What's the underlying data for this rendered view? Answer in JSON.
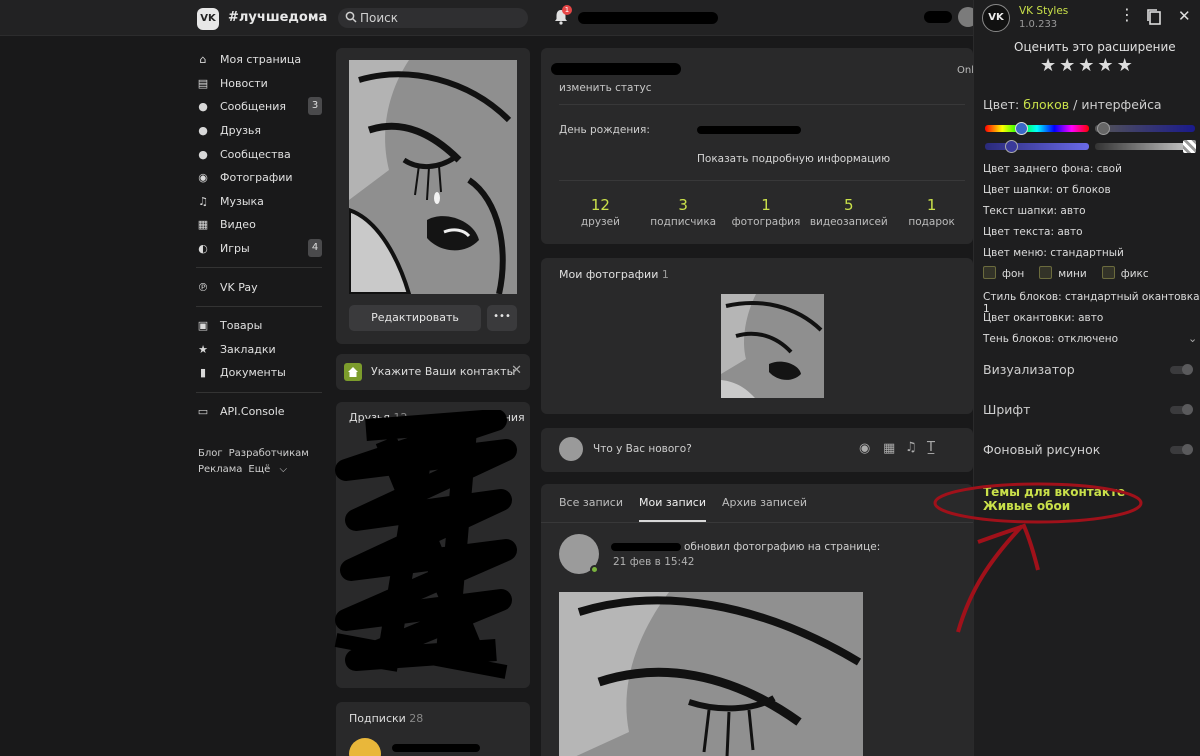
{
  "header": {
    "logo": "VK",
    "brand": "#лучшедома",
    "search_placeholder": "Поиск",
    "notif_count": "1"
  },
  "menu": [
    {
      "icon": "home-icon",
      "label": "Моя страница",
      "count": ""
    },
    {
      "icon": "news-icon",
      "label": "Новости",
      "count": ""
    },
    {
      "icon": "messages-icon",
      "label": "Сообщения",
      "count": "3"
    },
    {
      "icon": "friends-icon",
      "label": "Друзья",
      "count": ""
    },
    {
      "icon": "communities-icon",
      "label": "Сообщества",
      "count": ""
    },
    {
      "icon": "camera-icon",
      "label": "Фотографии",
      "count": ""
    },
    {
      "icon": "music-icon",
      "label": "Музыка",
      "count": ""
    },
    {
      "icon": "video-icon",
      "label": "Видео",
      "count": ""
    },
    {
      "icon": "gamepad-icon",
      "label": "Игры",
      "count": "4"
    }
  ],
  "menu2": [
    {
      "icon": "vkpay-icon",
      "label": "VK Pay"
    }
  ],
  "menu3": [
    {
      "icon": "bag-icon",
      "label": "Товары"
    },
    {
      "icon": "star-icon",
      "label": "Закладки"
    },
    {
      "icon": "document-icon",
      "label": "Документы"
    }
  ],
  "menu4": [
    {
      "icon": "api-icon",
      "label": "API.Console"
    }
  ],
  "footer": {
    "blog": "Блог",
    "dev": "Разработчикам",
    "ads": "Реклама",
    "more": "Ещё"
  },
  "profile": {
    "edit_button": "Редактировать",
    "more_button": "•••",
    "contacts_hint": "Укажите Ваши контакты",
    "friends_label": "Друзья",
    "friends_count": "12",
    "online_label": "обновления",
    "subs_label": "Подписки",
    "subs_count": "28",
    "status_link": "изменить статус",
    "online": "Onl",
    "birthday_label": "День рождения:",
    "show_more": "Показать подробную информацию"
  },
  "counters": [
    {
      "value": "12",
      "label": "друзей"
    },
    {
      "value": "3",
      "label": "подписчика"
    },
    {
      "value": "1",
      "label": "фотография"
    },
    {
      "value": "5",
      "label": "видеозаписей"
    },
    {
      "value": "1",
      "label": "подарок"
    }
  ],
  "photos": {
    "title": "Мои фотографии",
    "count": "1"
  },
  "composer": {
    "placeholder": "Что у Вас нового?"
  },
  "wall": {
    "tabs": [
      "Все записи",
      "Мои записи",
      "Архив записей"
    ],
    "active_tab": 1,
    "post_action": "обновил фотографию на странице:",
    "post_time": "21 фев в 15:42"
  },
  "panel": {
    "title": "VK Styles",
    "version": "1.0.233",
    "rate": "Оценить это расширение",
    "stars": 5,
    "color_label": "Цвет:",
    "color_blocks": "блоков",
    "color_sep": "/",
    "color_interface": "интерфейса",
    "rows": [
      "Цвет заднего фона: свой",
      "Цвет шапки: от блоков",
      "Текст шапки: авто",
      "Цвет текста: авто",
      "Цвет меню: стандартный"
    ],
    "checks": [
      "фон",
      "мини",
      "фикс"
    ],
    "rows2": [
      "Стиль блоков: стандартный окантовка 1",
      "Цвет окантовки: авто",
      "Тень блоков: отключено"
    ],
    "sections": [
      "Визуализатор",
      "Шрифт",
      "Фоновый рисунок"
    ],
    "link1": "Темы для вконтакте",
    "link2": "Живые обои",
    "accent_color": "#c9e04a",
    "annotation_color": "#a0111a"
  }
}
